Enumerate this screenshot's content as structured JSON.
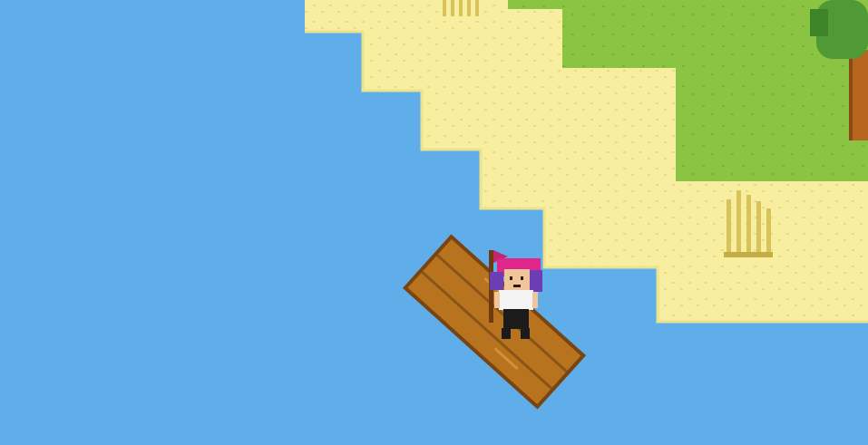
{
  "scene": {
    "title": "",
    "palette": {
      "water": "#5faeea",
      "sand": "#f7ef9f",
      "sand_speckle": "#e2d685",
      "grass": "#8bc442",
      "grass_speckle": "#7aae35",
      "tree_leaves": "#4f9a34",
      "tree_trunk": "#b5651d",
      "raft_wood": "#b8731f",
      "raft_dark": "#7a4410",
      "hair": "#e0268a",
      "hair_shadow": "#6b3fb3",
      "shirt": "#f4f4f4",
      "pants": "#1b1b1b",
      "skin": "#f2c49a",
      "flag": "#c0286e",
      "reed": "#d8c25a"
    },
    "objects": [
      {
        "name": "ocean",
        "icon": "water-tile"
      },
      {
        "name": "beach",
        "icon": "sand-tile"
      },
      {
        "name": "meadow",
        "icon": "grass-tile"
      },
      {
        "name": "palm-tree",
        "icon": "tree-icon"
      },
      {
        "name": "wooden-raft",
        "icon": "raft-icon"
      },
      {
        "name": "player",
        "icon": "character-sprite"
      },
      {
        "name": "reeds",
        "icon": "reed-icon"
      }
    ]
  }
}
